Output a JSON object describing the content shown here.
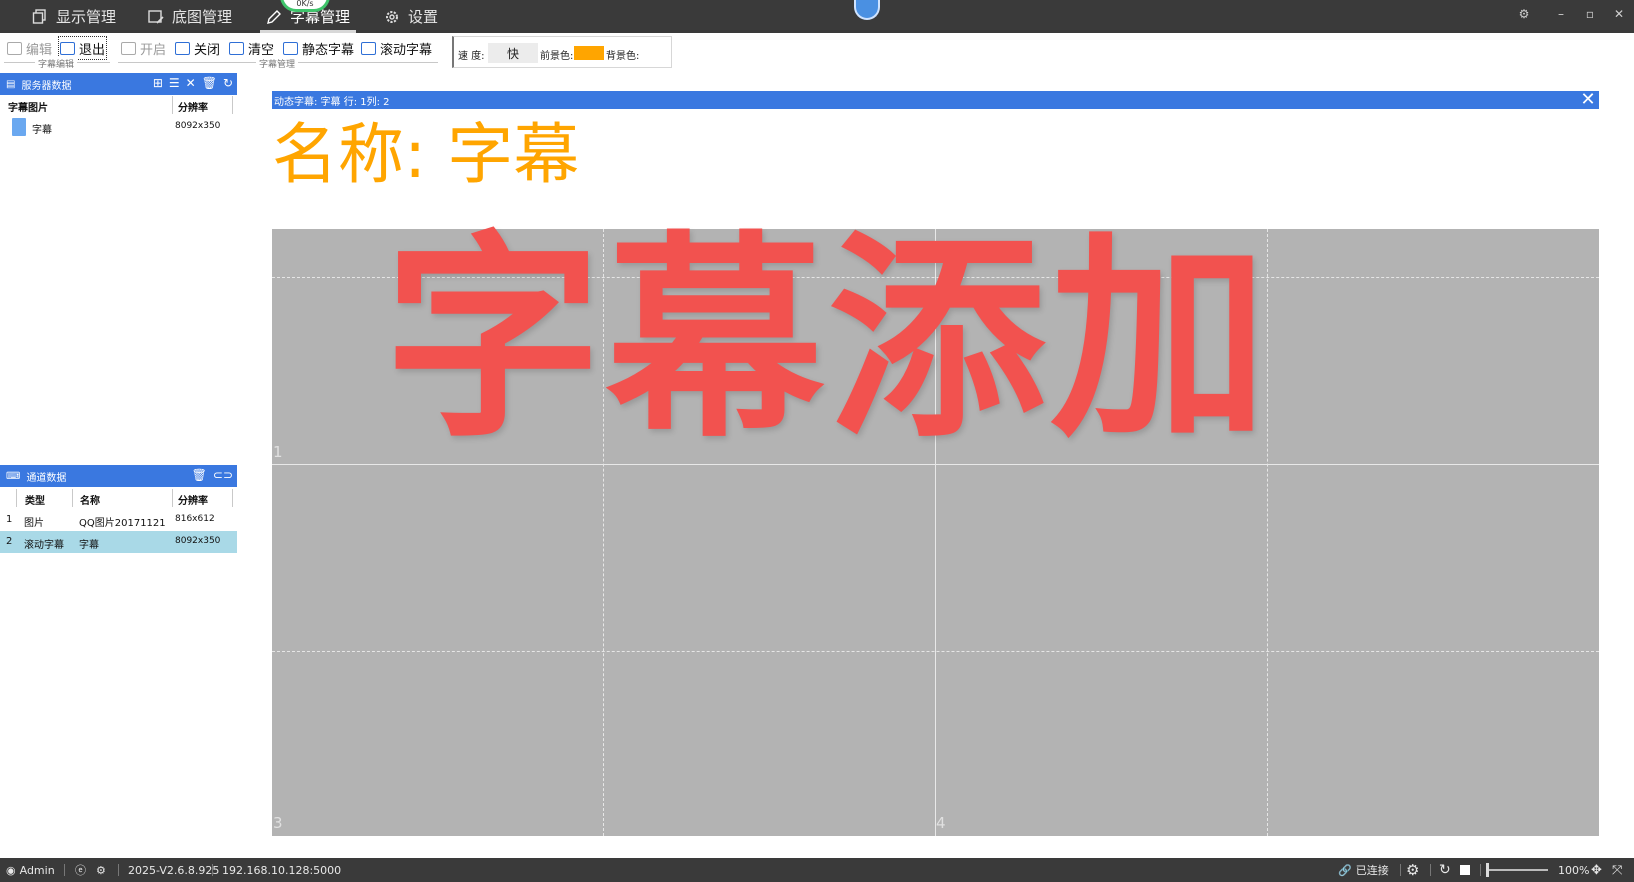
{
  "tabs": [
    {
      "label": "显示管理",
      "icon": "copy-icon"
    },
    {
      "label": "底图管理",
      "icon": "image-edit-icon"
    },
    {
      "label": "字幕管理",
      "icon": "pen-icon",
      "active": true
    },
    {
      "label": "设置",
      "icon": "gear-icon"
    }
  ],
  "net_speed": "0K/s",
  "toolbar": {
    "edit": "编辑",
    "exit": "退出",
    "group1": "字幕编辑",
    "open": "开启",
    "close": "关闭",
    "clear": "清空",
    "static": "静态字幕",
    "scroll": "滚动字幕",
    "group2": "字幕管理",
    "speed_label": "速 度:",
    "speed_value": "快",
    "fg_label": "前景色:",
    "fg_color": "#ffa500",
    "bg_label": "背景色:"
  },
  "server_panel": {
    "title": "服务器数据",
    "columns": [
      "字幕图片",
      "分辨率"
    ],
    "rows": [
      {
        "name": "字幕",
        "resolution": "8092x350"
      }
    ]
  },
  "channel_panel": {
    "title": "通道数据",
    "columns": [
      "类型",
      "名称",
      "分辨率"
    ],
    "rows": [
      {
        "index": "1",
        "type": "图片",
        "name": "QQ图片20171121",
        "resolution": "816x612"
      },
      {
        "index": "2",
        "type": "滚动字幕",
        "name": "字幕",
        "resolution": "8092x350",
        "selected": true
      }
    ]
  },
  "editor": {
    "bar_title": "动态字幕: 字幕   行: 1列: 2",
    "subtitle_text": "名称:  字幕",
    "subtitle_color": "#ffa500",
    "overlay_text": "字幕添加",
    "overlay_color": "#f2524f",
    "screen_numbers": [
      "1",
      "3",
      "4"
    ]
  },
  "status": {
    "user": "Admin",
    "version": "2025-V2.6.8.925",
    "address": "192.168.10.128:5000",
    "connection": "已连接",
    "zoom": "100%"
  }
}
